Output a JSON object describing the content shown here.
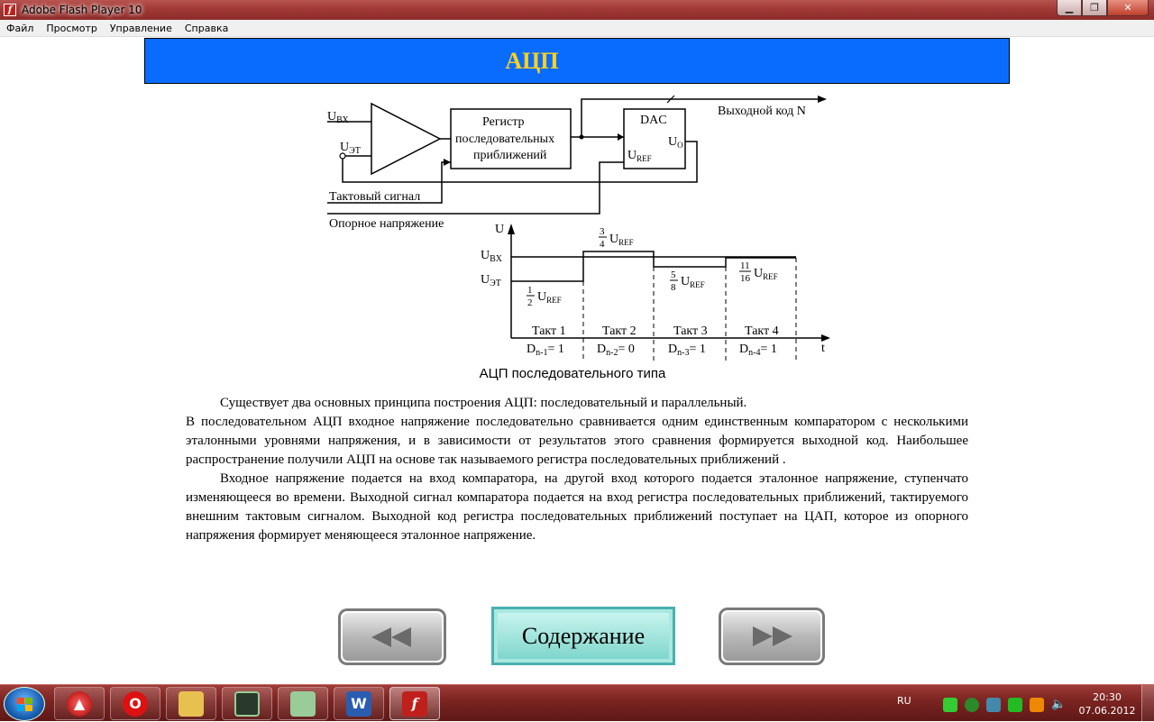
{
  "window": {
    "title": "Adobe Flash Player 10",
    "icon": "flash-icon",
    "controls": [
      "minimize",
      "maximize",
      "close"
    ]
  },
  "menu": [
    "Файл",
    "Просмотр",
    "Управление",
    "Справка"
  ],
  "header": {
    "title": "АЦП",
    "bg_color": "#0a6cff",
    "text_color": "#ffd21a"
  },
  "diagram": {
    "labels": {
      "u_in": "U",
      "u_in_sub": "ВХ",
      "u_ref_in": "U",
      "u_ref_in_sub": "ЭТ",
      "register_line1": "Регистр",
      "register_line2": "последовательных",
      "register_line3": "приближений",
      "dac": "DAC",
      "dac_uref": "U",
      "dac_uref_sub": "REF",
      "dac_uo": "U",
      "dac_uo_sub": "O",
      "output_code": "Выходной код N",
      "clock_signal": "Тактовый сигнал",
      "reference_voltage": "Опорное напряжение"
    },
    "timing": {
      "y_axis": "U",
      "x_axis": "t",
      "u_bx": "U",
      "u_bx_sub": "BX",
      "u_et": "U",
      "u_et_sub": "ЭТ",
      "steps": [
        {
          "num": "1",
          "den": "2",
          "label": "U",
          "sub": "REF",
          "tact": "Такт 1",
          "bit": "D",
          "bit_sub": "n-1",
          "bit_val": "= 1"
        },
        {
          "num": "3",
          "den": "4",
          "label": "U",
          "sub": "REF",
          "tact": "Такт 2",
          "bit": "D",
          "bit_sub": "n-2",
          "bit_val": "= 0"
        },
        {
          "num": "5",
          "den": "8",
          "label": "U",
          "sub": "REF",
          "tact": "Такт 3",
          "bit": "D",
          "bit_sub": "n-3",
          "bit_val": "= 1"
        },
        {
          "num": "11",
          "den": "16",
          "label": "U",
          "sub": "REF",
          "tact": "Такт 4",
          "bit": "D",
          "bit_sub": "n-4",
          "bit_val": "= 1"
        }
      ]
    },
    "caption": "АЦП последовательного типа"
  },
  "text": {
    "p1": "Существует два основных принципа построения АЦП: последовательный и параллельный.",
    "p2": "В последовательном АЦП входное напряжение последовательно сравнивается одним единственным компаратором с несколькими эталонными уровнями напряжения, и в зависимости от результатов этого сравнения формируется выходной код. Наибольшее распространение получили АЦП на основе так называемого регистра последовательных приближений .",
    "p3": "Входное напряжение подается на вход компаратора, на другой вход которого подается эталонное напряжение, ступенчато изменяющееся во времени. Выходной сигнал компаратора подается на вход регистра последовательных приближений, тактируемого внешним тактовым сигналом. Выходной код регистра последовательных приближений поступает на ЦАП, которое из опорного напряжения формирует меняющееся эталонное напряжение."
  },
  "nav": {
    "prev_icon": "rewind-icon",
    "contents_label": "Содержание",
    "next_icon": "fast-forward-icon"
  },
  "taskbar": {
    "items": [
      {
        "name": "antivirus-icon",
        "color": "#d22"
      },
      {
        "name": "opera-icon",
        "color": "#e11"
      },
      {
        "name": "explorer-icon",
        "color": "#e8c050"
      },
      {
        "name": "task-manager-icon",
        "color": "#4a8"
      },
      {
        "name": "tool-icon",
        "color": "#8c8"
      },
      {
        "name": "word-icon",
        "color": "#2a5db0"
      },
      {
        "name": "flash-player-icon",
        "color": "#c0201c"
      }
    ],
    "lang": "RU",
    "time": "20:30",
    "date": "07.06.2012"
  }
}
